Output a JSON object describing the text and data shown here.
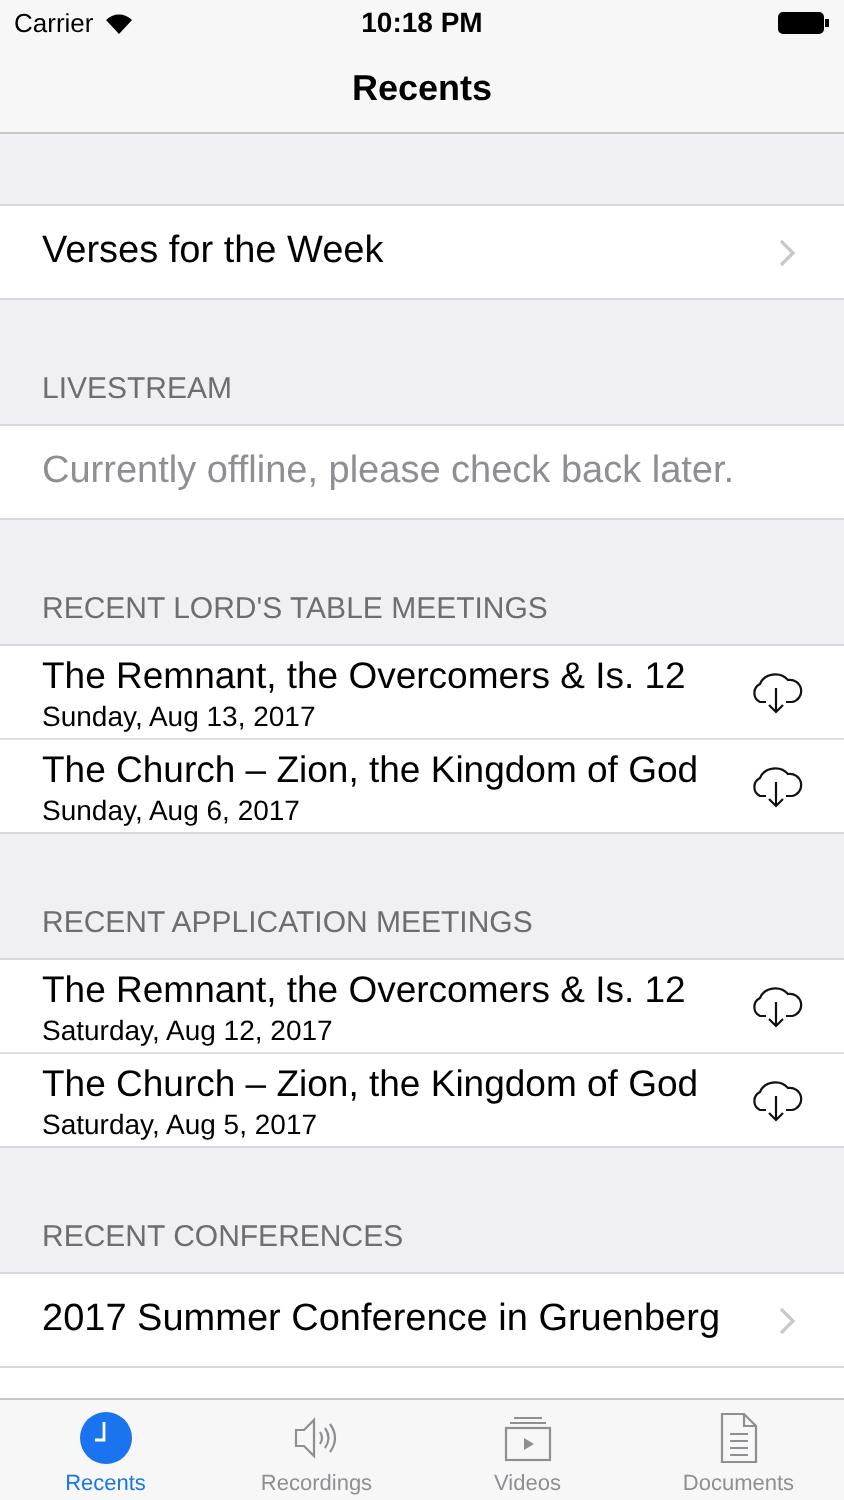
{
  "status_bar": {
    "carrier": "Carrier",
    "time": "10:18 PM"
  },
  "nav_bar": {
    "title": "Recents"
  },
  "sections": [
    {
      "rows": [
        {
          "kind": "link",
          "title": "Verses for the Week"
        }
      ]
    },
    {
      "header": "LIVESTREAM",
      "rows": [
        {
          "kind": "note",
          "title": "Currently offline, please check back later."
        }
      ]
    },
    {
      "header": "RECENT LORD'S TABLE MEETINGS",
      "rows": [
        {
          "kind": "download",
          "title": "The Remnant, the Overcomers & Is. 12",
          "subtitle": "Sunday, Aug 13, 2017"
        },
        {
          "kind": "download",
          "title": "The Church – Zion, the Kingdom of God",
          "subtitle": "Sunday, Aug 6, 2017"
        }
      ]
    },
    {
      "header": "RECENT APPLICATION MEETINGS",
      "rows": [
        {
          "kind": "download",
          "title": "The Remnant, the Overcomers & Is. 12",
          "subtitle": "Saturday, Aug 12, 2017"
        },
        {
          "kind": "download",
          "title": "The Church – Zion, the Kingdom of God",
          "subtitle": "Saturday, Aug 5, 2017"
        }
      ]
    },
    {
      "header": "RECENT CONFERENCES",
      "rows": [
        {
          "kind": "link",
          "title": "2017 Summer Conference in Gruenberg"
        }
      ]
    }
  ],
  "tab_bar": [
    {
      "kind": "clock",
      "label": "Recents",
      "selected": true
    },
    {
      "kind": "speaker",
      "label": "Recordings",
      "selected": false
    },
    {
      "kind": "video",
      "label": "Videos",
      "selected": false
    },
    {
      "kind": "document",
      "label": "Documents",
      "selected": false
    }
  ]
}
